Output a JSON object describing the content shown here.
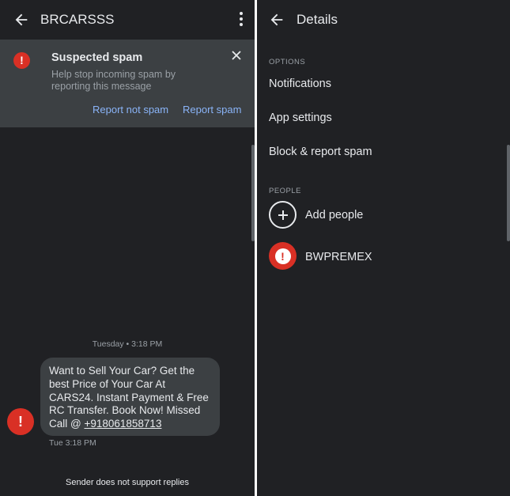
{
  "conversation": {
    "title": "BRCARSSS",
    "back_icon": "arrow-back-icon",
    "menu_icon": "more-vert-icon",
    "spam_banner": {
      "title": "Suspected spam",
      "subtitle": "Help stop incoming spam by reporting this message",
      "report_not_spam": "Report not spam",
      "report_spam": "Report spam",
      "alert_glyph": "!"
    },
    "date_separator": "Tuesday • 3:18 PM",
    "message": {
      "body": "Want to Sell Your Car? Get the best Price of Your Car At CARS24. Instant Payment & Free RC Transfer. Book Now! Missed Call @ ",
      "phone": "+918061858713",
      "time": "Tue 3:18 PM",
      "avatar_glyph": "!"
    },
    "footer_note": "Sender does not support replies"
  },
  "details": {
    "title": "Details",
    "options_label": "OPTIONS",
    "options": [
      "Notifications",
      "App settings",
      "Block & report spam"
    ],
    "people_label": "PEOPLE",
    "add_people": "Add people",
    "person": {
      "name": "BWPREMEX",
      "glyph": "!"
    }
  },
  "colors": {
    "background": "#202124",
    "surface": "#3c4043",
    "alert_red": "#d93025",
    "link_blue": "#8ab4f8",
    "text_primary": "#e8eaed",
    "text_secondary": "#9aa0a6"
  }
}
